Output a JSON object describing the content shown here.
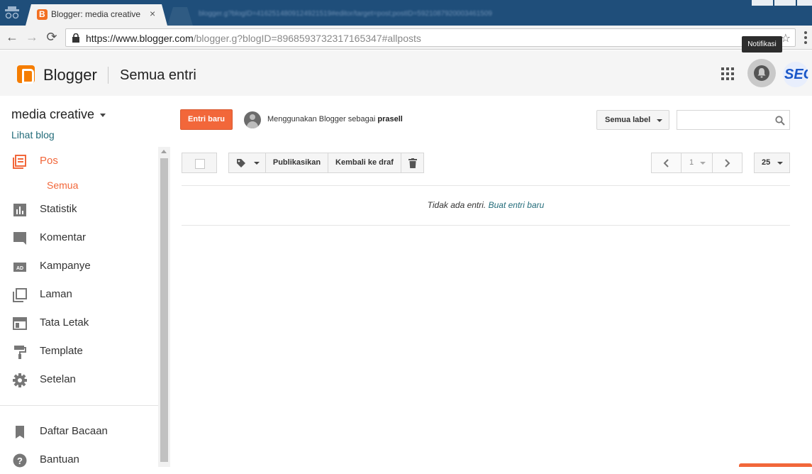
{
  "browser": {
    "tab_title": "Blogger: media creative",
    "tab_close": "×",
    "blurred_tab_url": "blogger.g?blogID=4162514809124921519#editor/target=post;postID=5921087920003461509",
    "url_host": "https://www.blogger.com",
    "url_path": "/blogger.g?blogID=8968593732317165347#allposts",
    "back": "←",
    "forward": "→",
    "reload": "⟳",
    "star": "☆"
  },
  "header": {
    "brand": "Blogger",
    "page_title": "Semua entri",
    "notification_tooltip": "Notifikasi",
    "seo_badge": "SEO"
  },
  "sidebar": {
    "blog_name": "media creative",
    "view_blog": "Lihat blog",
    "items": [
      {
        "label": "Pos",
        "icon": "posts-icon"
      },
      {
        "label": "Statistik",
        "icon": "stats-icon"
      },
      {
        "label": "Komentar",
        "icon": "comment-icon"
      },
      {
        "label": "Kampanye",
        "icon": "ad-icon"
      },
      {
        "label": "Laman",
        "icon": "pages-icon"
      },
      {
        "label": "Tata Letak",
        "icon": "layout-icon"
      },
      {
        "label": "Template",
        "icon": "paint-roller-icon"
      },
      {
        "label": "Setelan",
        "icon": "gear-icon"
      },
      {
        "label": "Daftar Bacaan",
        "icon": "bookmark-icon"
      },
      {
        "label": "Bantuan",
        "icon": "help-icon"
      }
    ],
    "subitem": "Semua"
  },
  "main": {
    "new_post": "Entri baru",
    "using_prefix": "Menggunakan Blogger sebagai",
    "username": "prasell",
    "label_select": "Semua label",
    "search_placeholder": "",
    "toolbar": {
      "publish": "Publikasikan",
      "revert_draft": "Kembali ke draf"
    },
    "pagination": {
      "page": "1",
      "per_page": "25",
      "prev": "‹",
      "next": "›"
    },
    "empty_text": "Tidak ada entri.",
    "empty_link": "Buat entri baru"
  },
  "colors": {
    "accent": "#f2673a",
    "link": "#236c7a",
    "brand": "#f57d00"
  }
}
